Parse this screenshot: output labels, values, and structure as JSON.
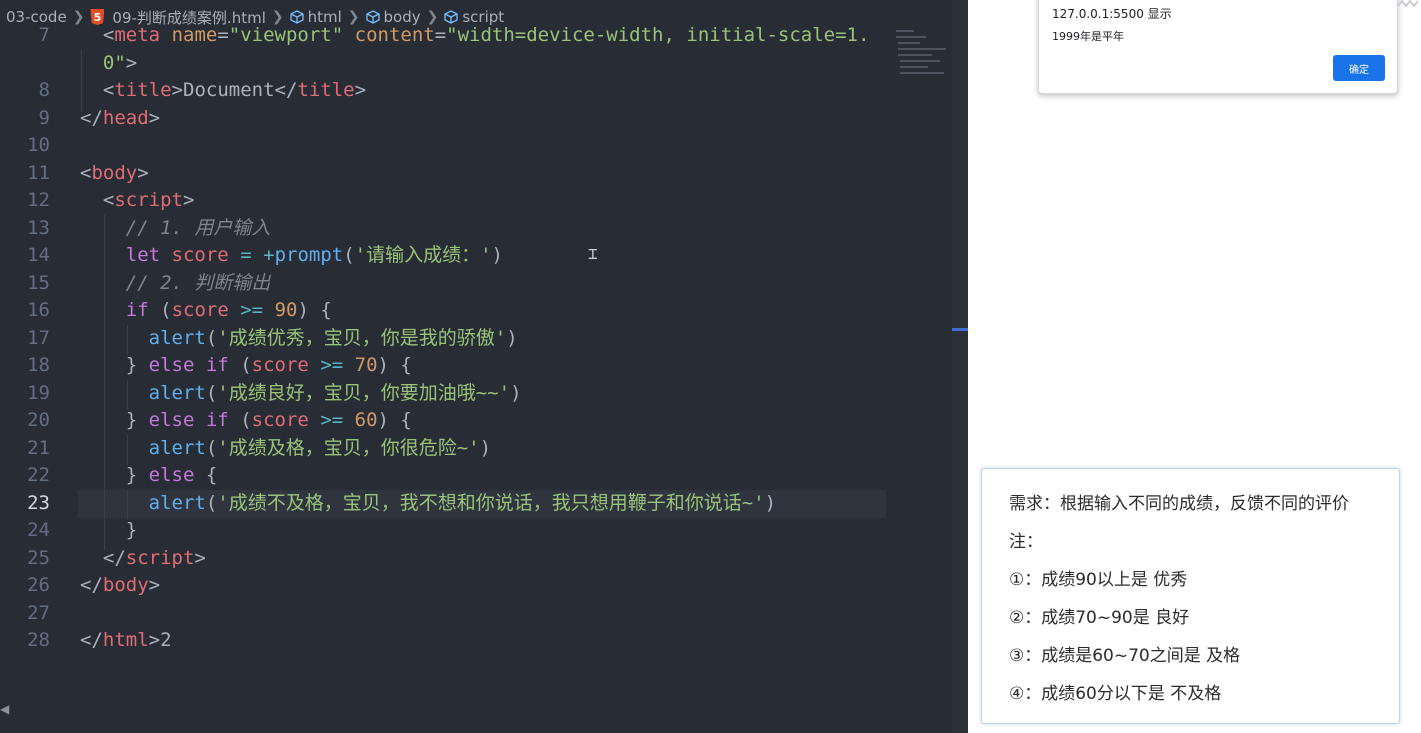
{
  "breadcrumb": {
    "folder": "03-code",
    "file": "09-判断成绩案例.html",
    "html": "html",
    "body": "body",
    "script": "script",
    "html5_badge": "5"
  },
  "editor": {
    "active_line": 23,
    "lines": [
      {
        "n": "7",
        "html": "  <span class=\"punc\">&lt;</span><span class=\"tag\">meta</span> <span class=\"attr\">name</span><span class=\"punc\">=</span><span class=\"str\">\"viewport\"</span> <span class=\"attr\">content</span><span class=\"punc\">=</span><span class=\"str\">\"width=device-width, initial-scale=1.</span>"
      },
      {
        "n": "",
        "html": "  <span class=\"str\">0\"</span><span class=\"punc\">&gt;</span>"
      },
      {
        "n": "8",
        "html": "  <span class=\"punc\">&lt;</span><span class=\"tag\">title</span><span class=\"punc\">&gt;</span>Document<span class=\"punc\">&lt;/</span><span class=\"tag\">title</span><span class=\"punc\">&gt;</span>"
      },
      {
        "n": "9",
        "html": "<span class=\"punc\">&lt;/</span><span class=\"tag\">head</span><span class=\"punc\">&gt;</span>"
      },
      {
        "n": "10",
        "html": ""
      },
      {
        "n": "11",
        "html": "<span class=\"punc\">&lt;</span><span class=\"tag\">body</span><span class=\"punc\">&gt;</span>"
      },
      {
        "n": "12",
        "html": "  <span class=\"punc\">&lt;</span><span class=\"tag\">script</span><span class=\"punc\">&gt;</span>"
      },
      {
        "n": "13",
        "html": "    <span class=\"cmt\">// 1. 用户输入</span>"
      },
      {
        "n": "14",
        "html": "    <span class=\"kw\">let</span> <span class=\"var\">score</span> <span class=\"op\">=</span> <span class=\"op\">+</span><span class=\"fn\">prompt</span><span class=\"punc\">(</span><span class=\"str\">'请输入成绩：'</span><span class=\"punc\">)</span>"
      },
      {
        "n": "15",
        "html": "    <span class=\"cmt\">// 2. 判断输出</span>"
      },
      {
        "n": "16",
        "html": "    <span class=\"kw\">if</span> <span class=\"punc\">(</span><span class=\"var\">score</span> <span class=\"op\">&gt;=</span> <span class=\"num\">90</span><span class=\"punc\">) {</span>"
      },
      {
        "n": "17",
        "html": "      <span class=\"fn\">alert</span><span class=\"punc\">(</span><span class=\"str\">'成绩优秀，宝贝，你是我的骄傲'</span><span class=\"punc\">)</span>"
      },
      {
        "n": "18",
        "html": "    <span class=\"punc\">}</span> <span class=\"kw\">else if</span> <span class=\"punc\">(</span><span class=\"var\">score</span> <span class=\"op\">&gt;=</span> <span class=\"num\">70</span><span class=\"punc\">) {</span>"
      },
      {
        "n": "19",
        "html": "      <span class=\"fn\">alert</span><span class=\"punc\">(</span><span class=\"str\">'成绩良好，宝贝，你要加油哦~~'</span><span class=\"punc\">)</span>"
      },
      {
        "n": "20",
        "html": "    <span class=\"punc\">}</span> <span class=\"kw\">else if</span> <span class=\"punc\">(</span><span class=\"var\">score</span> <span class=\"op\">&gt;=</span> <span class=\"num\">60</span><span class=\"punc\">) {</span>"
      },
      {
        "n": "21",
        "html": "      <span class=\"fn\">alert</span><span class=\"punc\">(</span><span class=\"str\">'成绩及格，宝贝，你很危险~'</span><span class=\"punc\">)</span>"
      },
      {
        "n": "22",
        "html": "    <span class=\"punc\">}</span> <span class=\"kw\">else</span> <span class=\"punc\">{</span>"
      },
      {
        "n": "23",
        "html": "      <span class=\"fn\">alert</span><span class=\"punc\">(</span><span class=\"str\">'成绩不及格，宝贝，我不想和你说话，我只想用鞭子和你说话~'</span><span class=\"punc\">)</span>"
      },
      {
        "n": "24",
        "html": "    <span class=\"punc\">}</span>"
      },
      {
        "n": "25",
        "html": "  <span class=\"punc\">&lt;/</span><span class=\"tag\">script</span><span class=\"punc\">&gt;</span>"
      },
      {
        "n": "26",
        "html": "<span class=\"punc\">&lt;/</span><span class=\"tag\">body</span><span class=\"punc\">&gt;</span>"
      },
      {
        "n": "27",
        "html": ""
      },
      {
        "n": "28",
        "html": "<span class=\"punc\">&lt;/</span><span class=\"tag\">html</span><span class=\"punc\">&gt;</span>2"
      }
    ]
  },
  "alert": {
    "origin": "127.0.0.1:5500 显示",
    "message": "1999年是平年",
    "ok_label": "确定"
  },
  "requirements": {
    "title": "需求：根据输入不同的成绩，反馈不同的评价",
    "note": "注：",
    "items": [
      "①：成绩90以上是 优秀",
      "②：成绩70~90是 良好",
      "③：成绩是60~70之间是 及格",
      "④：成绩60分以下是 不及格"
    ]
  },
  "icons": {
    "chevron": "chevron-right-icon",
    "cube": "symbol-cube-icon"
  },
  "colors": {
    "editor_bg": "#282c34",
    "accent": "#1a73e8"
  }
}
